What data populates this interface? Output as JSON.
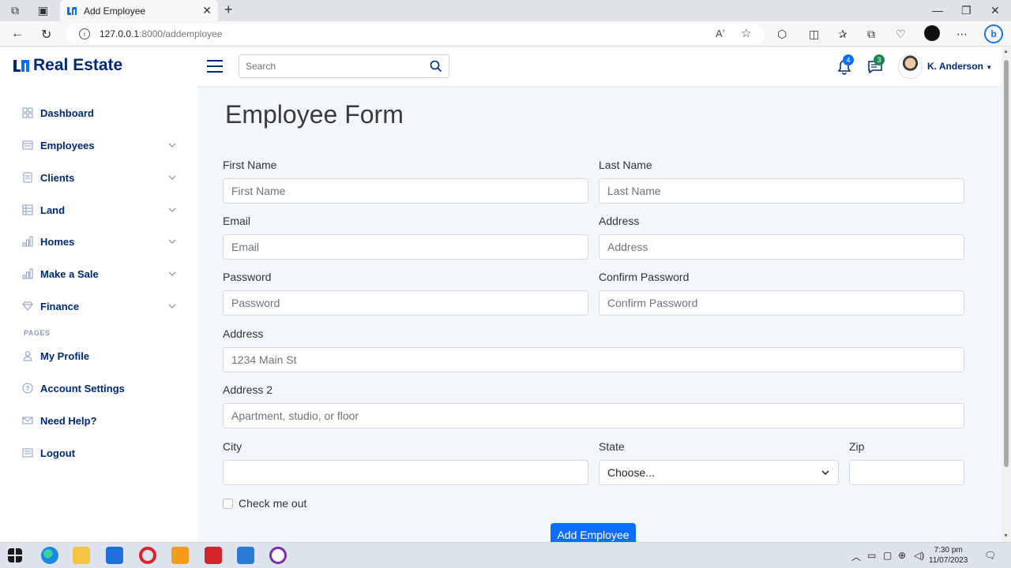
{
  "browser": {
    "tab_title": "Add Employee",
    "url_host": "127.0.0.1",
    "url_path": ":8000/addemployee"
  },
  "header": {
    "brand": "Real Estate",
    "search_placeholder": "Search",
    "notifications_count": "4",
    "messages_count": "3",
    "user_name": "K. Anderson"
  },
  "sidebar": {
    "items": [
      {
        "label": "Dashboard"
      },
      {
        "label": "Employees"
      },
      {
        "label": "Clients"
      },
      {
        "label": "Land"
      },
      {
        "label": "Homes"
      },
      {
        "label": "Make a Sale"
      },
      {
        "label": "Finance"
      }
    ],
    "pages_heading": "PAGES",
    "pages": [
      {
        "label": "My Profile"
      },
      {
        "label": "Account Settings"
      },
      {
        "label": "Need Help?"
      },
      {
        "label": "Logout"
      }
    ]
  },
  "form": {
    "title": "Employee Form",
    "first_name_label": "First Name",
    "first_name_placeholder": "First Name",
    "last_name_label": "Last Name",
    "last_name_placeholder": "Last Name",
    "email_label": "Email",
    "email_placeholder": "Email",
    "address_label": "Address",
    "address_placeholder": "Address",
    "password_label": "Password",
    "password_placeholder": "Password",
    "confirm_password_label": "Confirm Password",
    "confirm_password_placeholder": "Confirm Password",
    "address_full_label": "Address",
    "address_full_placeholder": "1234 Main St",
    "address2_label": "Address 2",
    "address2_placeholder": "Apartment, studio, or floor",
    "city_label": "City",
    "state_label": "State",
    "state_selected": "Choose...",
    "zip_label": "Zip",
    "checkbox_label": "Check me out",
    "submit_label": "Add Employee"
  },
  "taskbar": {
    "time": "7:30 pm",
    "date": "11/07/2023"
  },
  "colors": {
    "brand": "#012970",
    "primary_button": "#0d6efd",
    "notification_badge": "#0d6efd",
    "message_badge": "#198754",
    "page_bg": "#f3f6fb"
  }
}
